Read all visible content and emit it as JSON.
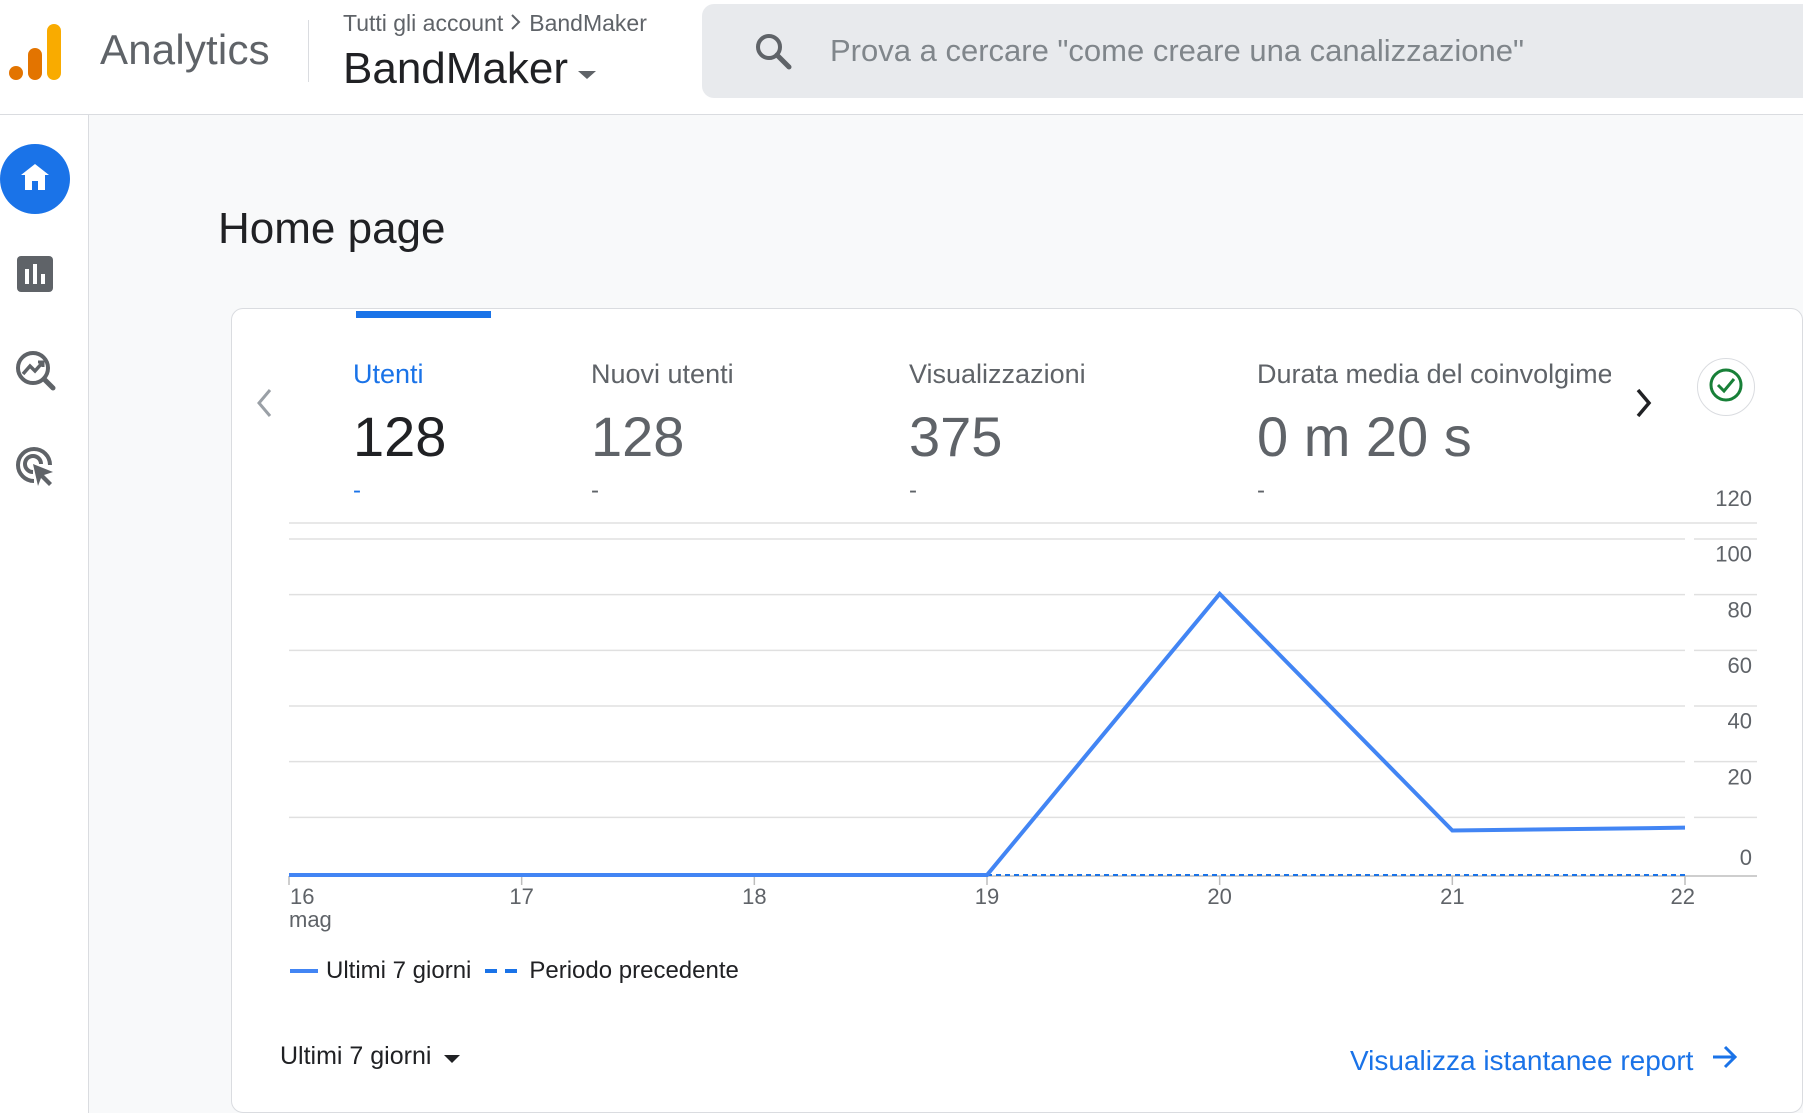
{
  "app": {
    "title": "Analytics"
  },
  "header": {
    "breadcrumb": {
      "root": "Tutti gli account",
      "current": "BandMaker"
    },
    "property": "BandMaker",
    "search": {
      "placeholder": "Prova a cercare \"come creare una canalizzazione\"",
      "value": ""
    }
  },
  "nav": {
    "items": [
      {
        "name": "home",
        "icon": "home-icon",
        "active": true
      },
      {
        "name": "reports",
        "icon": "bar-chart-icon",
        "active": false
      },
      {
        "name": "explore",
        "icon": "explore-trend-icon",
        "active": false
      },
      {
        "name": "advertising",
        "icon": "target-cursor-icon",
        "active": false
      }
    ]
  },
  "page": {
    "title": "Home page"
  },
  "card": {
    "metrics": [
      {
        "label": "Utenti",
        "value": "128",
        "delta": "-",
        "active": true
      },
      {
        "label": "Nuovi utenti",
        "value": "128",
        "delta": "-",
        "active": false
      },
      {
        "label": "Visualizzazioni",
        "value": "375",
        "delta": "-",
        "active": false
      },
      {
        "label": "Durata media del coinvolgimento",
        "value": "0 m 20 s",
        "delta": "-",
        "active": false
      }
    ],
    "status_icon": "check-circle-icon",
    "range_label": "Ultimi 7 giorni",
    "report_link": "Visualizza istantanee report"
  },
  "colors": {
    "accent": "#1a73e8",
    "line": "#4285f4",
    "check": "#188038"
  },
  "chart_data": {
    "type": "line",
    "x": [
      "16",
      "17",
      "18",
      "19",
      "20",
      "21",
      "22"
    ],
    "x_sublabel_first": "mag",
    "yticks": [
      0,
      20,
      40,
      60,
      80,
      100,
      120
    ],
    "ylim": [
      0,
      120
    ],
    "axis_position": "right",
    "grid": true,
    "legend_position": "bottom-left",
    "series": [
      {
        "name": "Ultimi 7 giorni",
        "style": "solid",
        "values": [
          0,
          0,
          0,
          0,
          101,
          16,
          17
        ]
      },
      {
        "name": "Periodo precedente",
        "style": "dashed",
        "x_start_index": 3,
        "values": [
          0,
          0,
          0,
          0
        ]
      }
    ]
  }
}
